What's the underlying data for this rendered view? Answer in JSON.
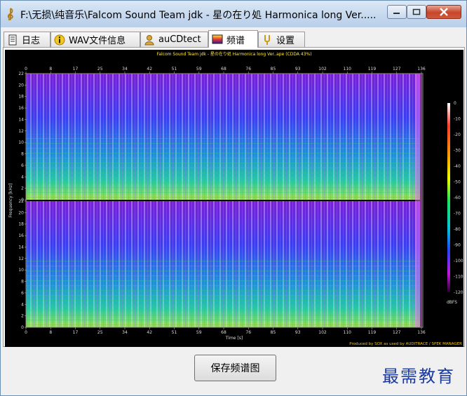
{
  "window": {
    "title": "F:\\无损\\纯音乐\\Falcom Sound Team jdk - 星の在り処 Harmonica long Ver.....",
    "minimize_label": "–",
    "maximize_label": "□",
    "close_label": "✕"
  },
  "tabs": [
    {
      "label": "日志",
      "icon": "log-icon",
      "active": false
    },
    {
      "label": "WAV文件信息",
      "icon": "info-icon",
      "active": false
    },
    {
      "label": "auCDtect",
      "icon": "person-icon",
      "active": false
    },
    {
      "label": "频谱",
      "icon": "spectrum-icon",
      "active": true
    },
    {
      "label": "设置",
      "icon": "tuning-fork-icon",
      "active": false
    }
  ],
  "spectrogram": {
    "header": "Falcom Sound Team jdk - 星の在り処 Harmonica long Ver..ape (CDDA 43%)",
    "x_ticks": [
      "0",
      "8",
      "17",
      "25",
      "34",
      "42",
      "51",
      "59",
      "68",
      "76",
      "85",
      "93",
      "102",
      "110",
      "119",
      "127",
      "136"
    ],
    "x_label": "Time [s]",
    "y_label": "Frequency [kHz]",
    "y_ticks": [
      "22",
      "20",
      "18",
      "16",
      "14",
      "12",
      "10",
      "8",
      "6",
      "4",
      "2",
      "0"
    ],
    "colorbar_unit": "dBFS",
    "colorbar_ticks": [
      "0",
      "-10",
      "-20",
      "-30",
      "-40",
      "-50",
      "-60",
      "-70",
      "-80",
      "-90",
      "-100",
      "-110",
      "-120"
    ],
    "footer": "Produced by SOX as used by AUDITRACE / SPEK MANAGER"
  },
  "save_button_label": "保存频谱图",
  "watermark": "最需教育",
  "colors": {
    "titlebar": "#c4d7ee",
    "close_red": "#c7452b",
    "plot_bg": "#000000",
    "watermark": "#1a3aa0"
  }
}
